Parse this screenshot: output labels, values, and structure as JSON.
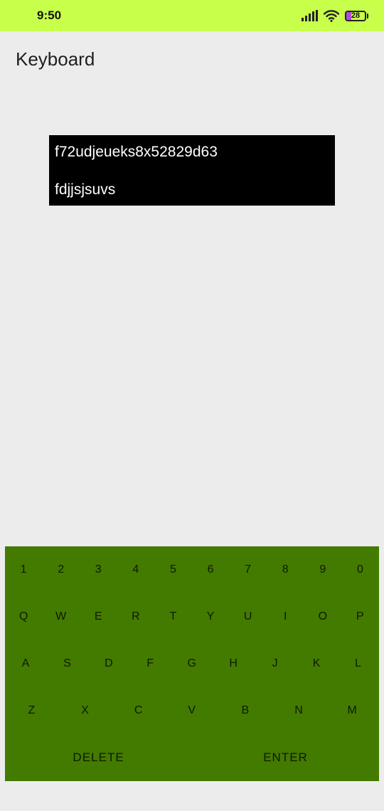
{
  "status_bar": {
    "time": "9:50",
    "battery": "28",
    "battery_level": 0.28,
    "icons": [
      "signal-icon",
      "wifi-icon",
      "battery-icon"
    ],
    "background": "#c8ff4a"
  },
  "header": {
    "title": "Keyboard"
  },
  "display": {
    "lines": [
      "f72udjeueks8x52829d63",
      "fdjjsjsuvs"
    ]
  },
  "keyboard": {
    "background": "#437a00",
    "rows": [
      [
        "1",
        "2",
        "3",
        "4",
        "5",
        "6",
        "7",
        "8",
        "9",
        "0"
      ],
      [
        "Q",
        "W",
        "E",
        "R",
        "T",
        "Y",
        "U",
        "I",
        "O",
        "P"
      ],
      [
        "A",
        "S",
        "D",
        "F",
        "G",
        "H",
        "J",
        "K",
        "L"
      ],
      [
        "Z",
        "X",
        "C",
        "V",
        "B",
        "N",
        "M"
      ]
    ],
    "actions": {
      "delete": "DELETE",
      "enter": "ENTER"
    }
  }
}
